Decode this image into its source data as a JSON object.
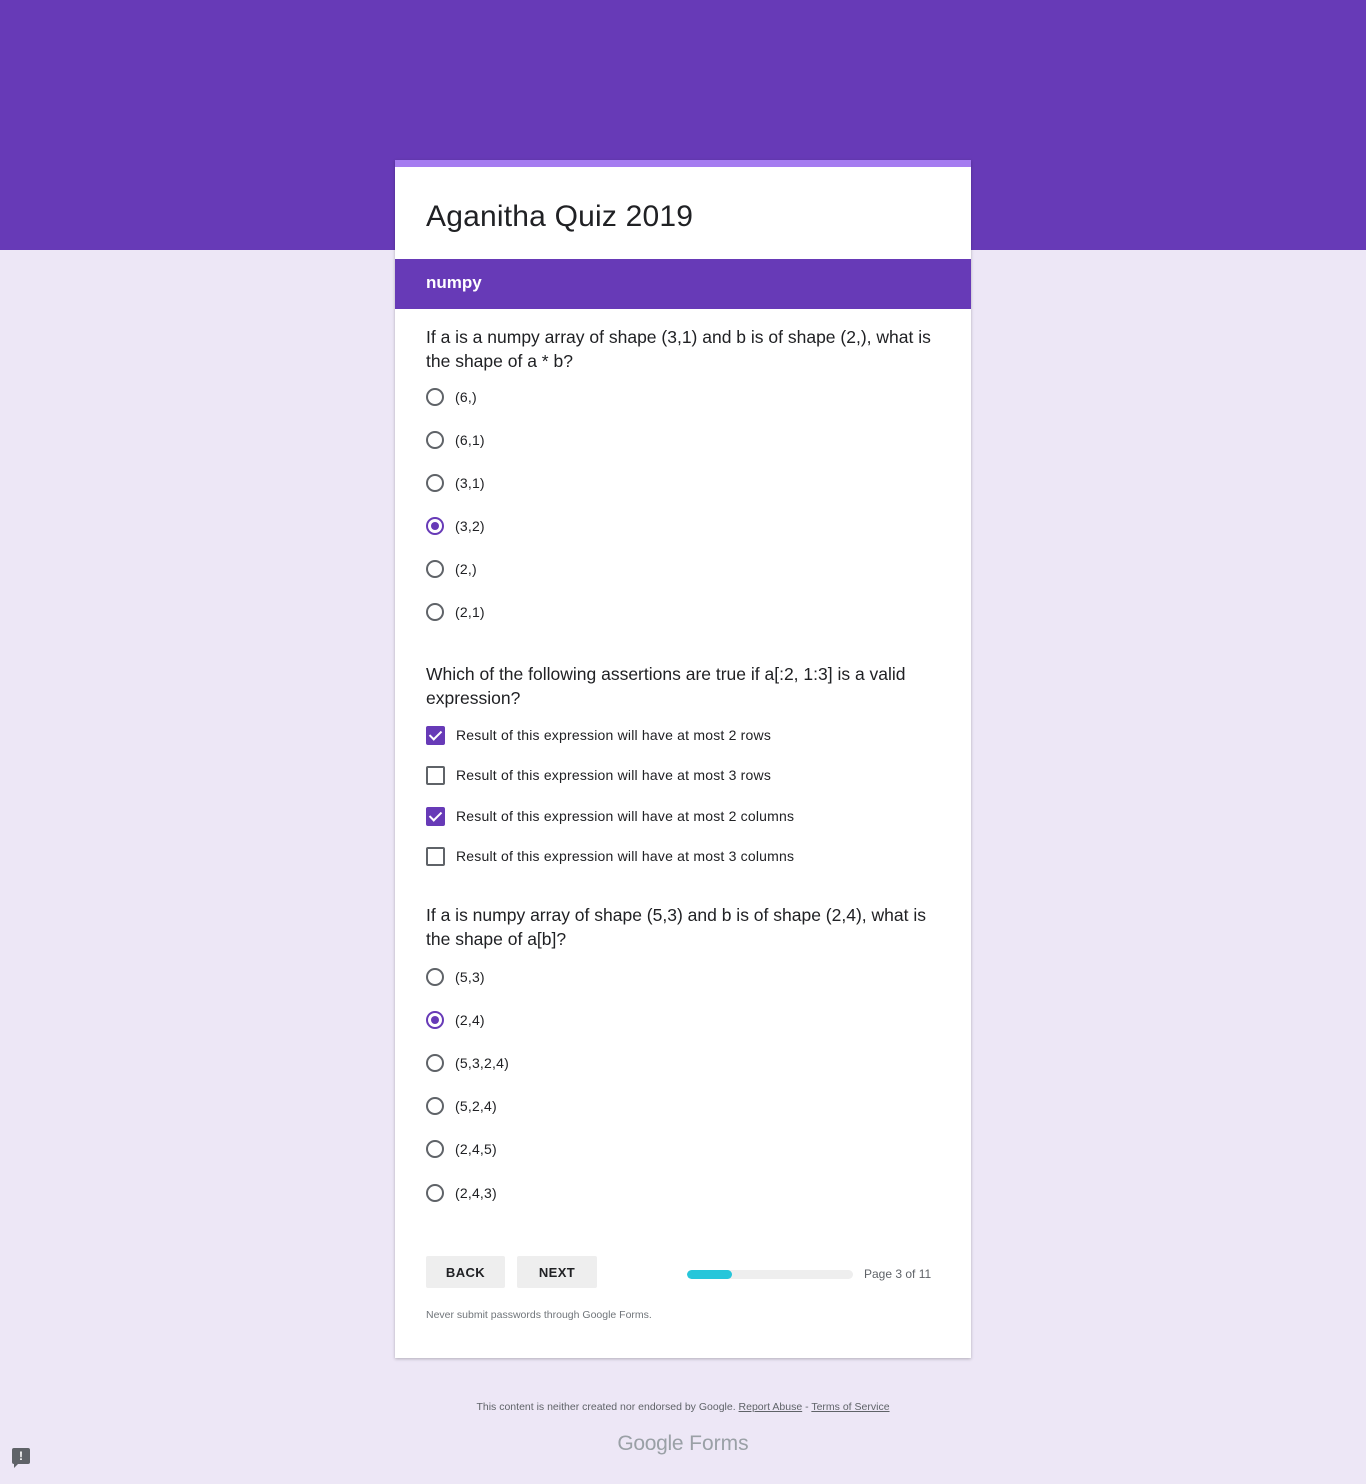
{
  "form": {
    "title": "Aganitha Quiz 2019",
    "section_title": "numpy"
  },
  "questions": [
    {
      "text": "If a is a numpy array of shape (3,1) and b is of shape (2,), what is the shape of a * b?",
      "type": "radio",
      "options": [
        {
          "label": "(6,)",
          "checked": false
        },
        {
          "label": "(6,1)",
          "checked": false
        },
        {
          "label": "(3,1)",
          "checked": false
        },
        {
          "label": "(3,2)",
          "checked": true
        },
        {
          "label": "(2,)",
          "checked": false
        },
        {
          "label": "(2,1)",
          "checked": false
        }
      ]
    },
    {
      "text": "Which of the following assertions are true if a[:2, 1:3] is a valid expression?",
      "type": "checkbox",
      "options": [
        {
          "label": "Result of this expression will have at most 2 rows",
          "checked": true
        },
        {
          "label": "Result of this expression will have at most 3 rows",
          "checked": false
        },
        {
          "label": "Result of this expression will have at most 2 columns",
          "checked": true
        },
        {
          "label": "Result of this expression will have at most 3 columns",
          "checked": false
        }
      ]
    },
    {
      "text": "If a is numpy array of shape (5,3) and b is of shape (2,4), what is the shape of a[b]?",
      "type": "radio",
      "options": [
        {
          "label": "(5,3)",
          "checked": false
        },
        {
          "label": "(2,4)",
          "checked": true
        },
        {
          "label": "(5,3,2,4)",
          "checked": false
        },
        {
          "label": "(5,2,4)",
          "checked": false
        },
        {
          "label": "(2,4,5)",
          "checked": false
        },
        {
          "label": "(2,4,3)",
          "checked": false
        }
      ]
    }
  ],
  "navigation": {
    "back_label": "BACK",
    "next_label": "NEXT",
    "progress_fraction": 0.27,
    "page_indicator": "Page 3 of 11"
  },
  "warning_text": "Never submit passwords through Google Forms.",
  "footer": {
    "disclaimer": "This content is neither created nor endorsed by Google.",
    "report_abuse": "Report Abuse",
    "separator": " - ",
    "terms": "Terms of Service",
    "brand_google": "Google",
    "brand_forms": "Forms"
  },
  "colors": {
    "brand_purple": "#673ab7",
    "progress_fill": "#26c6da",
    "page_background": "#ede7f6"
  },
  "icons": {
    "feedback": "feedback-icon"
  }
}
